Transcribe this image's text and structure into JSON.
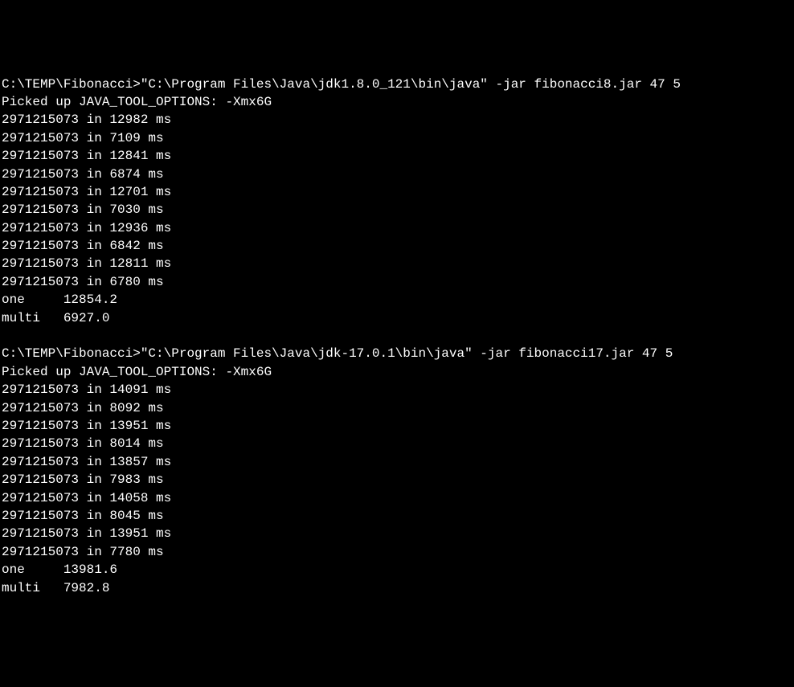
{
  "run1": {
    "prompt": "C:\\TEMP\\Fibonacci>",
    "command": "\"C:\\Program Files\\Java\\jdk1.8.0_121\\bin\\java\" -jar fibonacci8.jar 47 5",
    "picked_up": "Picked up JAVA_TOOL_OPTIONS: -Xmx6G",
    "lines": [
      "2971215073 in 12982 ms",
      "2971215073 in 7109 ms",
      "2971215073 in 12841 ms",
      "2971215073 in 6874 ms",
      "2971215073 in 12701 ms",
      "2971215073 in 7030 ms",
      "2971215073 in 12936 ms",
      "2971215073 in 6842 ms",
      "2971215073 in 12811 ms",
      "2971215073 in 6780 ms"
    ],
    "summary_one": "one     12854.2",
    "summary_multi": "multi   6927.0"
  },
  "run2": {
    "prompt": "C:\\TEMP\\Fibonacci>",
    "command": "\"C:\\Program Files\\Java\\jdk-17.0.1\\bin\\java\" -jar fibonacci17.jar 47 5",
    "picked_up": "Picked up JAVA_TOOL_OPTIONS: -Xmx6G",
    "lines": [
      "2971215073 in 14091 ms",
      "2971215073 in 8092 ms",
      "2971215073 in 13951 ms",
      "2971215073 in 8014 ms",
      "2971215073 in 13857 ms",
      "2971215073 in 7983 ms",
      "2971215073 in 14058 ms",
      "2971215073 in 8045 ms",
      "2971215073 in 13951 ms",
      "2971215073 in 7780 ms"
    ],
    "summary_one": "one     13981.6",
    "summary_multi": "multi   7982.8"
  }
}
